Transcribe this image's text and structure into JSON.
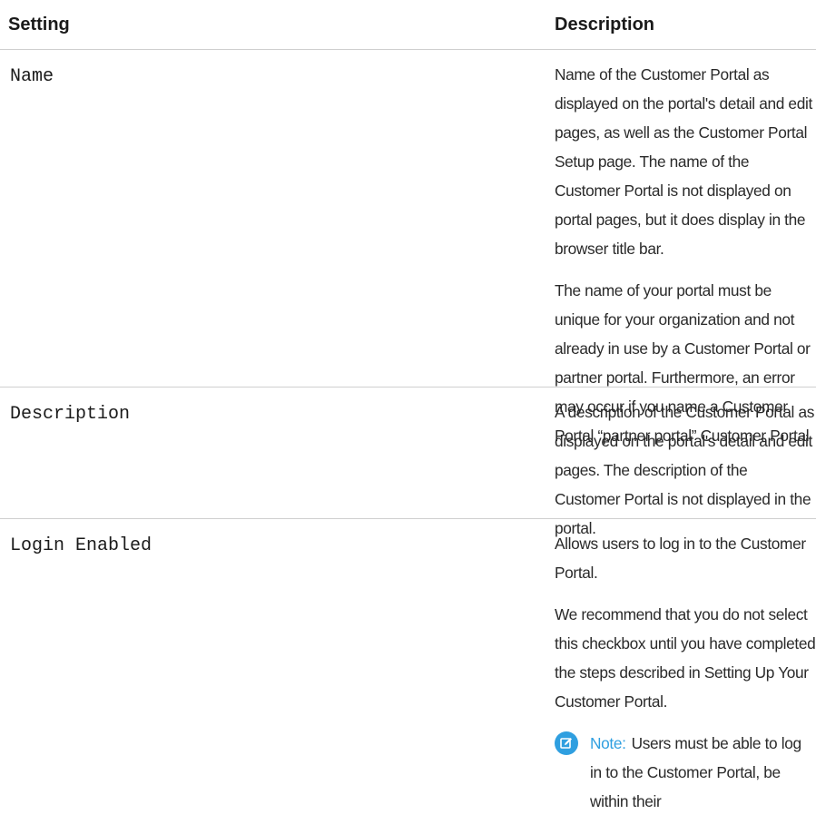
{
  "table": {
    "headers": {
      "setting": "Setting",
      "description": "Description"
    },
    "rows": [
      {
        "setting": "Name",
        "paragraphs": [
          "Name of the Customer Portal as displayed on the portal's detail and edit pages, as well as the Customer Portal Setup page. The name of the Customer Portal is not displayed on portal pages, but it does display in the browser title bar.",
          "The name of your portal must be unique for your organization and not already in use by a Customer Portal or partner portal. Furthermore, an error may occur if you name a Customer Portal “partner portal” Customer Portal"
        ]
      },
      {
        "setting": "Description",
        "paragraphs": [
          "A description of the Customer Portal as displayed on the portal's detail and edit pages. The description of the Customer Portal is not displayed in the portal."
        ]
      },
      {
        "setting": "Login Enabled",
        "paragraphs": [
          "Allows users to log in to the Customer Portal.",
          "We recommend that you do not select this checkbox until you have completed the steps described in Setting Up Your Customer Portal."
        ],
        "note": {
          "icon": "edit-note-icon",
          "label": "Note:",
          "text": "Users must be able to log in to the Customer Portal, be within their"
        }
      }
    ]
  },
  "colors": {
    "accent": "#2f9fe0",
    "divider": "#cfcfcf",
    "text": "#1a1a1a"
  }
}
